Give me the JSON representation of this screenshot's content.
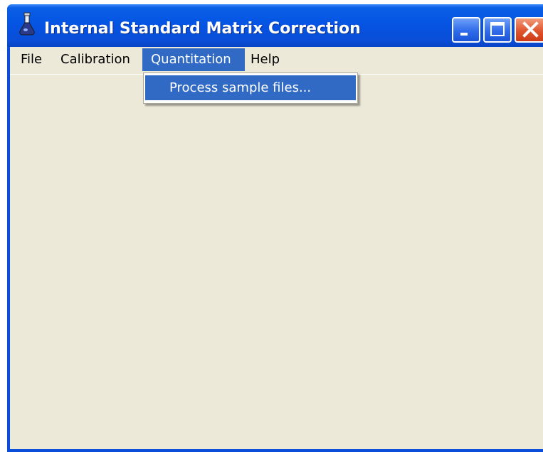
{
  "window": {
    "title": "Internal Standard Matrix Correction"
  },
  "menubar": {
    "items": [
      {
        "label": "File"
      },
      {
        "label": "Calibration"
      },
      {
        "label": "Quantitation"
      },
      {
        "label": "Help"
      }
    ]
  },
  "quantitation_menu": {
    "items": [
      {
        "label": "Process sample files..."
      }
    ]
  },
  "icons": {
    "app": "flask-icon",
    "minimize": "minimize-icon",
    "maximize": "maximize-icon",
    "close": "close-icon"
  },
  "colors": {
    "titlebar": "#0554e3",
    "menu_highlight": "#316ac5",
    "client_background": "#ece9d8",
    "close_button": "#e0562e"
  }
}
